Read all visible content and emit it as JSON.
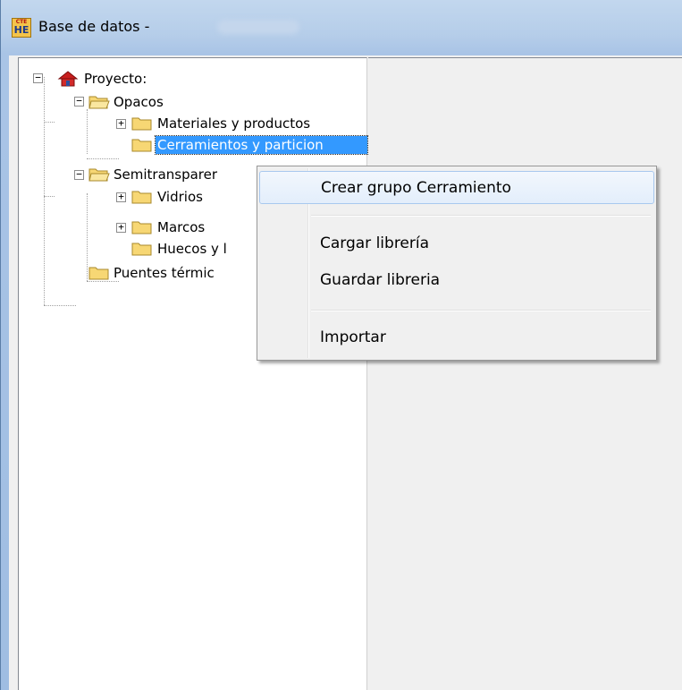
{
  "window": {
    "title": "Base de datos -",
    "app_icon_top": "CTE",
    "app_icon_bottom": "HE"
  },
  "tree": {
    "root": "Proyecto:",
    "opacos": "Opacos",
    "materiales": "Materiales y productos",
    "cerramientos": "Cerramientos y particion",
    "semitransparentes": "Semitransparer",
    "vidrios": "Vidrios",
    "marcos": "Marcos",
    "huecos": "Huecos y l",
    "puentes": "Puentes térmic"
  },
  "context_menu": {
    "crear_grupo": "Crear grupo Cerramiento",
    "cargar_libreria": "Cargar librería",
    "guardar_libreria": "Guardar libreria",
    "importar": "Importar"
  },
  "colors": {
    "selection": "#3399ff",
    "folder_fill": "#f7d774",
    "house_red": "#c81e1e"
  }
}
